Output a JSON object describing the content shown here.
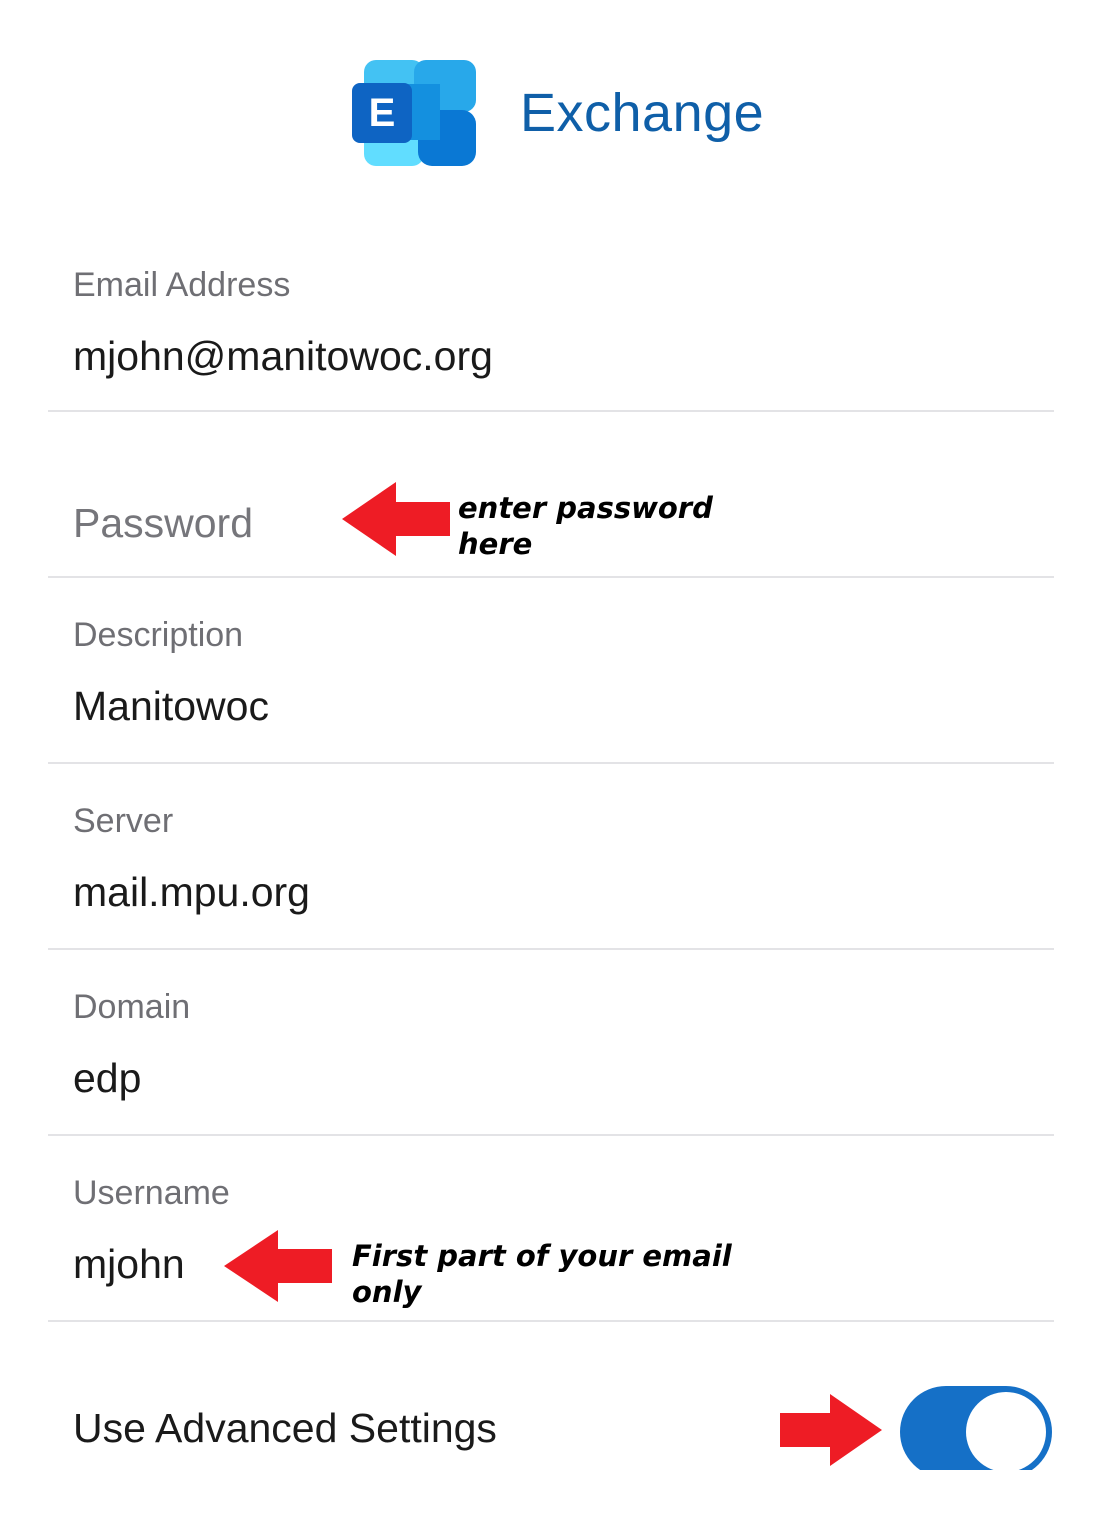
{
  "header": {
    "logo_letter": "E",
    "title": "Exchange"
  },
  "fields": {
    "email": {
      "label": "Email Address",
      "value": "mjohn@manitowoc.org"
    },
    "password": {
      "placeholder": "Password"
    },
    "description": {
      "label": "Description",
      "value": "Manitowoc"
    },
    "server": {
      "label": "Server",
      "value": "mail.mpu.org"
    },
    "domain": {
      "label": "Domain",
      "value": "edp"
    },
    "username": {
      "label": "Username",
      "value": "mjohn"
    }
  },
  "advanced": {
    "label": "Use Advanced Settings",
    "enabled": true
  },
  "annotations": {
    "password_note": [
      "enter password",
      "here"
    ],
    "username_note": [
      "First part of your email",
      "only"
    ]
  },
  "colors": {
    "brand_blue": "#0f5fa8",
    "toggle_on": "#1570c7",
    "arrow_red": "#ee1c25"
  }
}
